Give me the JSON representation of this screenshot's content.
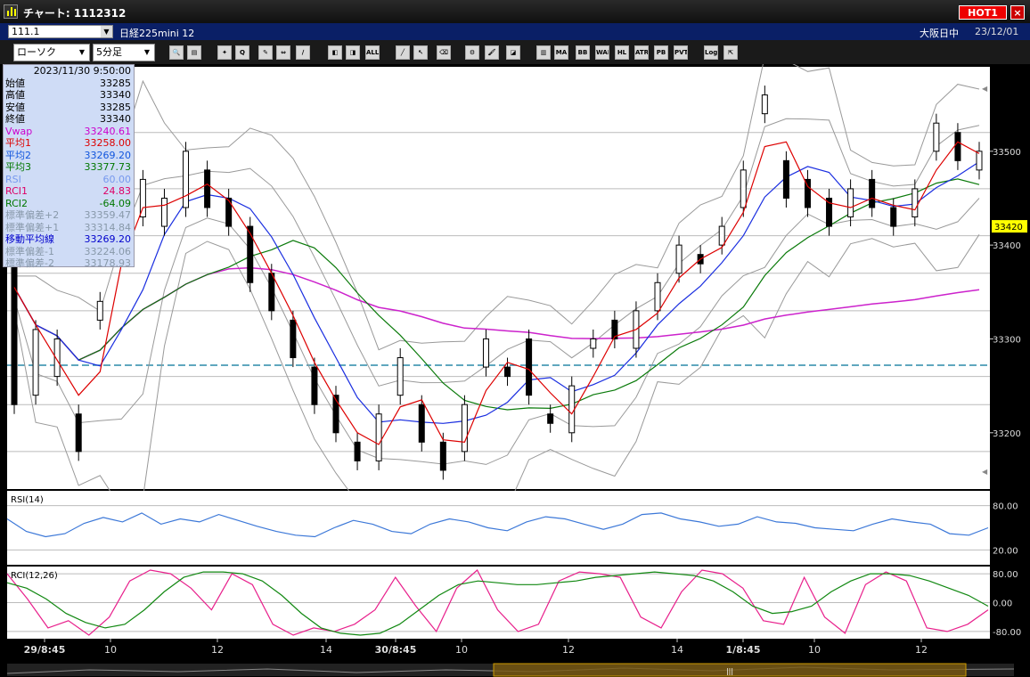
{
  "window": {
    "title": "チャート: 1112312",
    "hot_label": "HOT1",
    "close_label": "×"
  },
  "infobar": {
    "code": "111.1",
    "instrument": "日経225mini 12",
    "session": "大阪日中",
    "date": "23/12/01"
  },
  "toolbar": {
    "chart_type": "ローソク",
    "timeframe": "5分足",
    "buttons": [
      {
        "name": "zoom-icon",
        "label": "🔍"
      },
      {
        "name": "split-icon",
        "label": "▤"
      },
      {
        "name": "crosshair-icon",
        "label": "✦"
      },
      {
        "name": "search-chart-icon",
        "label": "Q"
      },
      {
        "name": "drawing-icon",
        "label": "✎"
      },
      {
        "name": "arrows-icon",
        "label": "⇔"
      },
      {
        "name": "pencil-gray-icon",
        "label": "∕"
      },
      {
        "name": "candle-left-icon",
        "label": "◧"
      },
      {
        "name": "candle-right-icon",
        "label": "◨"
      },
      {
        "name": "all-icon",
        "label": "ALL"
      },
      {
        "name": "line-tool-icon",
        "label": "╱"
      },
      {
        "name": "cursor-icon",
        "label": "↖"
      },
      {
        "name": "eraser-icon",
        "label": "⌫"
      },
      {
        "name": "settings-icon",
        "label": "⚙"
      },
      {
        "name": "brush-icon",
        "label": "🖌"
      },
      {
        "name": "color-icon",
        "label": "◪"
      },
      {
        "name": "bars-icon",
        "label": "▥"
      },
      {
        "name": "ma-icon",
        "label": "MA"
      },
      {
        "name": "bb-icon",
        "label": "BB"
      },
      {
        "name": "wae-icon",
        "label": "WAE"
      },
      {
        "name": "hl-icon",
        "label": "HL"
      },
      {
        "name": "atr-icon",
        "label": "ATR"
      },
      {
        "name": "pb-icon",
        "label": "PB"
      },
      {
        "name": "pvt-icon",
        "label": "PVT"
      },
      {
        "name": "log-icon",
        "label": "Log"
      },
      {
        "name": "export-icon",
        "label": "⇱"
      }
    ]
  },
  "ohlc_panel": {
    "datetime": "2023/11/30 9:50:00",
    "rows": [
      {
        "label": "始値",
        "value": "33285",
        "color": "#000000"
      },
      {
        "label": "高値",
        "value": "33340",
        "color": "#000000"
      },
      {
        "label": "安値",
        "value": "33285",
        "color": "#000000"
      },
      {
        "label": "終値",
        "value": "33340",
        "color": "#000000"
      },
      {
        "label": "Vwap",
        "value": "33240.61",
        "color": "#cc00cc"
      },
      {
        "label": "平均1",
        "value": "33258.00",
        "color": "#dd0000"
      },
      {
        "label": "平均2",
        "value": "33269.20",
        "color": "#1155dd"
      },
      {
        "label": "平均3",
        "value": "33377.73",
        "color": "#007700"
      },
      {
        "label": "RSI",
        "value": "60.00",
        "color": "#7799ee"
      },
      {
        "label": "RCI1",
        "value": "24.83",
        "color": "#dd0066"
      },
      {
        "label": "RCI2",
        "value": "-64.09",
        "color": "#007700"
      },
      {
        "label": "標準偏差+2",
        "value": "33359.47",
        "color": "#8899aa"
      },
      {
        "label": "標準偏差+1",
        "value": "33314.84",
        "color": "#8899aa"
      },
      {
        "label": "移動平均線",
        "value": "33269.20",
        "color": "#0000cc"
      },
      {
        "label": "標準偏差-1",
        "value": "33224.06",
        "color": "#8899aa"
      },
      {
        "label": "標準偏差-2",
        "value": "33178.93",
        "color": "#8899aa"
      }
    ]
  },
  "chart_data": [
    {
      "type": "candlestick",
      "title": "",
      "yticks": [
        33200,
        33300,
        33400,
        33500
      ],
      "ylim": [
        33140,
        33590
      ],
      "current_price": "33420",
      "dashed_level": 33272,
      "xticks": [
        "29/8:45",
        "10",
        "12",
        "14",
        "30/8:45",
        "10",
        "12",
        "14",
        "1/8:45",
        "10",
        "12"
      ],
      "series": [
        {
          "name": "平均1",
          "color": "#dd0000"
        },
        {
          "name": "平均2",
          "color": "#1a2ee0"
        },
        {
          "name": "平均3",
          "color": "#0a7a0a"
        },
        {
          "name": "Vwap",
          "color": "#cc22cc"
        },
        {
          "name": "標準偏差",
          "color": "#999999"
        }
      ],
      "candles_approx": [
        [
          33480,
          33230
        ],
        [
          33240,
          33310
        ],
        [
          33260,
          33300
        ],
        [
          33220,
          33180
        ],
        [
          33320,
          33340
        ],
        [
          33400,
          33460
        ],
        [
          33430,
          33470
        ],
        [
          33420,
          33450
        ],
        [
          33440,
          33500
        ],
        [
          33480,
          33440
        ],
        [
          33450,
          33420
        ],
        [
          33420,
          33360
        ],
        [
          33370,
          33330
        ],
        [
          33320,
          33280
        ],
        [
          33270,
          33230
        ],
        [
          33240,
          33200
        ],
        [
          33190,
          33170
        ],
        [
          33170,
          33220
        ],
        [
          33240,
          33280
        ],
        [
          33230,
          33190
        ],
        [
          33190,
          33160
        ],
        [
          33180,
          33230
        ],
        [
          33270,
          33300
        ],
        [
          33270,
          33260
        ],
        [
          33300,
          33240
        ],
        [
          33220,
          33210
        ],
        [
          33200,
          33250
        ],
        [
          33290,
          33300
        ],
        [
          33320,
          33300
        ],
        [
          33290,
          33330
        ],
        [
          33330,
          33360
        ],
        [
          33370,
          33400
        ],
        [
          33390,
          33380
        ],
        [
          33400,
          33420
        ],
        [
          33440,
          33480
        ],
        [
          33540,
          33560
        ],
        [
          33490,
          33450
        ],
        [
          33470,
          33440
        ],
        [
          33450,
          33420
        ],
        [
          33430,
          33460
        ],
        [
          33470,
          33440
        ],
        [
          33440,
          33420
        ],
        [
          33430,
          33460
        ],
        [
          33500,
          33530
        ],
        [
          33520,
          33490
        ],
        [
          33480,
          33500
        ]
      ]
    },
    {
      "type": "line",
      "title": "RSI(14)",
      "yticks": [
        "80.00",
        "20.00"
      ],
      "ylim": [
        0,
        100
      ],
      "series": [
        {
          "name": "RSI",
          "color": "#3c78d8",
          "values": [
            62,
            45,
            38,
            42,
            56,
            64,
            58,
            70,
            55,
            62,
            58,
            68,
            60,
            52,
            45,
            40,
            38,
            50,
            60,
            55,
            45,
            42,
            55,
            62,
            58,
            50,
            46,
            58,
            65,
            62,
            55,
            48,
            55,
            68,
            70,
            62,
            58,
            52,
            55,
            65,
            58,
            56,
            50,
            48,
            46,
            55,
            62,
            58,
            55,
            42,
            40,
            50
          ]
        }
      ]
    },
    {
      "type": "line",
      "title": "RCI(12,26)",
      "yticks": [
        "80.00",
        "0.00",
        "-80.00"
      ],
      "ylim": [
        -100,
        100
      ],
      "series": [
        {
          "name": "RCI1",
          "color": "#e8208c",
          "values": [
            80,
            10,
            -70,
            -50,
            -90,
            -40,
            60,
            90,
            80,
            40,
            -20,
            80,
            50,
            -60,
            -90,
            -70,
            -80,
            -60,
            -20,
            70,
            -10,
            -80,
            40,
            90,
            -20,
            -80,
            -60,
            60,
            85,
            80,
            70,
            -40,
            -70,
            30,
            90,
            80,
            40,
            -50,
            -60,
            70,
            -40,
            -85,
            50,
            85,
            60,
            -70,
            -80,
            -60,
            -20
          ]
        },
        {
          "name": "RCI2",
          "color": "#118811",
          "values": [
            55,
            40,
            10,
            -30,
            -55,
            -70,
            -60,
            -20,
            30,
            70,
            85,
            85,
            80,
            60,
            20,
            -30,
            -70,
            -85,
            -90,
            -85,
            -60,
            -20,
            20,
            50,
            60,
            55,
            50,
            50,
            55,
            60,
            70,
            75,
            80,
            85,
            80,
            75,
            60,
            30,
            -10,
            -30,
            -25,
            -10,
            30,
            60,
            80,
            80,
            75,
            60,
            40,
            20,
            -10
          ]
        }
      ]
    }
  ],
  "chart_labels": {
    "price_ticks": [
      "33500",
      "33400",
      "33300",
      "33200"
    ],
    "current": "33420"
  },
  "colors": {
    "grid": "#c8c8c8",
    "bg": "#ffffff",
    "infobar": "#0a1f66",
    "price_tag": "#ffff00"
  }
}
